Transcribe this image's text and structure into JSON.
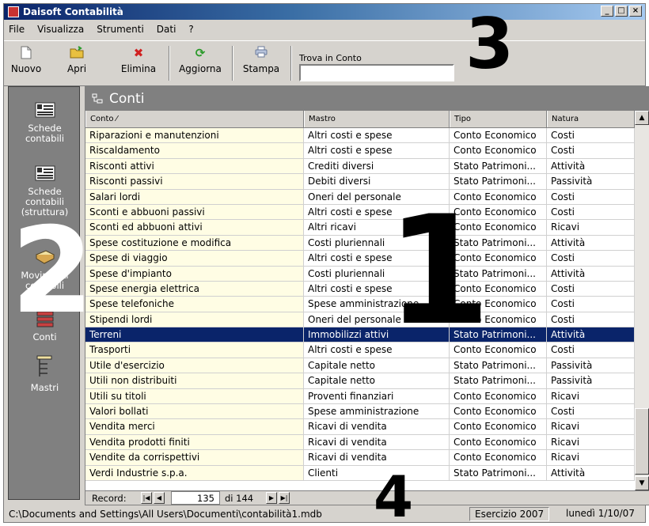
{
  "window": {
    "title": "Daisoft Contabilità",
    "buttons": [
      "_",
      "□",
      "×"
    ]
  },
  "menu": [
    "File",
    "Visualizza",
    "Strumenti",
    "Dati",
    "?"
  ],
  "toolbar": {
    "buttons": [
      {
        "label": "Nuovo",
        "icon": "new-document-icon"
      },
      {
        "label": "Apri",
        "icon": "open-folder-icon"
      },
      {
        "label": "Elimina",
        "icon": "delete-x-icon"
      },
      {
        "label": "Aggiorna",
        "icon": "refresh-arrows-icon"
      },
      {
        "label": "Stampa",
        "icon": "printer-icon"
      }
    ],
    "search_label": "Trova in Conto",
    "search_value": ""
  },
  "sidebar": {
    "items": [
      {
        "label": "Schede\ncontabili",
        "icon": "ledger-card-icon"
      },
      {
        "label": "Schede\ncontabili\n(struttura)",
        "icon": "ledger-card-icon"
      },
      {
        "label": "Movimenti\ncontabili",
        "icon": "journal-pen-icon"
      },
      {
        "label": "Conti",
        "icon": "accounts-stack-icon"
      },
      {
        "label": "Mastri",
        "icon": "tree-list-icon"
      }
    ]
  },
  "panel": {
    "title": "Conti"
  },
  "grid": {
    "columns": [
      "Conto ⁄",
      "Mastro",
      "Tipo",
      "Natura"
    ],
    "rows": [
      [
        "Riparazioni e manutenzioni",
        "Altri costi e spese",
        "Conto Economico",
        "Costi"
      ],
      [
        "Riscaldamento",
        "Altri costi e spese",
        "Conto Economico",
        "Costi"
      ],
      [
        "Risconti attivi",
        "Crediti diversi",
        "Stato Patrimoni...",
        "Attività"
      ],
      [
        "Risconti passivi",
        "Debiti diversi",
        "Stato Patrimoni...",
        "Passività"
      ],
      [
        "Salari lordi",
        "Oneri del personale",
        "Conto Economico",
        "Costi"
      ],
      [
        "Sconti e abbuoni passivi",
        "Altri costi e spese",
        "Conto Economico",
        "Costi"
      ],
      [
        "Sconti ed abbuoni attivi",
        "Altri ricavi",
        "Conto Economico",
        "Ricavi"
      ],
      [
        "Spese costituzione e modifica",
        "Costi pluriennali",
        "Stato Patrimoni...",
        "Attività"
      ],
      [
        "Spese di viaggio",
        "Altri costi e spese",
        "Conto Economico",
        "Costi"
      ],
      [
        "Spese d'impianto",
        "Costi pluriennali",
        "Stato Patrimoni...",
        "Attività"
      ],
      [
        "Spese energia elettrica",
        "Altri costi e spese",
        "Conto Economico",
        "Costi"
      ],
      [
        "Spese telefoniche",
        "Spese amministrazione",
        "Conto Economico",
        "Costi"
      ],
      [
        "Stipendi lordi",
        "Oneri del personale",
        "Conto Economico",
        "Costi"
      ],
      [
        "Terreni",
        "Immobilizzi attivi",
        "Stato Patrimoni...",
        "Attività"
      ],
      [
        "Trasporti",
        "Altri costi e spese",
        "Conto Economico",
        "Costi"
      ],
      [
        "Utile d'esercizio",
        "Capitale netto",
        "Stato Patrimoni...",
        "Passività"
      ],
      [
        "Utili non distribuiti",
        "Capitale netto",
        "Stato Patrimoni...",
        "Passività"
      ],
      [
        "Utili su titoli",
        "Proventi finanziari",
        "Conto Economico",
        "Ricavi"
      ],
      [
        "Valori bollati",
        "Spese amministrazione",
        "Conto Economico",
        "Costi"
      ],
      [
        "Vendita merci",
        "Ricavi di vendita",
        "Conto Economico",
        "Ricavi"
      ],
      [
        "Vendita prodotti finiti",
        "Ricavi di vendita",
        "Conto Economico",
        "Ricavi"
      ],
      [
        "Vendite da corrispettivi",
        "Ricavi di vendita",
        "Conto Economico",
        "Ricavi"
      ],
      [
        "Verdi Industrie s.p.a.",
        "Clienti",
        "Stato Patrimoni...",
        "Attività"
      ]
    ],
    "selected_row": 13
  },
  "record_nav": {
    "label": "Record:",
    "current": "135",
    "of_text": "di 144"
  },
  "statusbar": {
    "path": "C:\\Documents and Settings\\All Users\\Documenti\\contabilità1.mdb",
    "esercizio": "Esercizio 2007",
    "date": "lunedì 1/10/07"
  },
  "callouts": [
    "1",
    "2",
    "3",
    "4"
  ],
  "colors": {
    "selection": "#0a246a",
    "first_column_bg": "#fffde4",
    "sidebar_bg": "#808080"
  }
}
